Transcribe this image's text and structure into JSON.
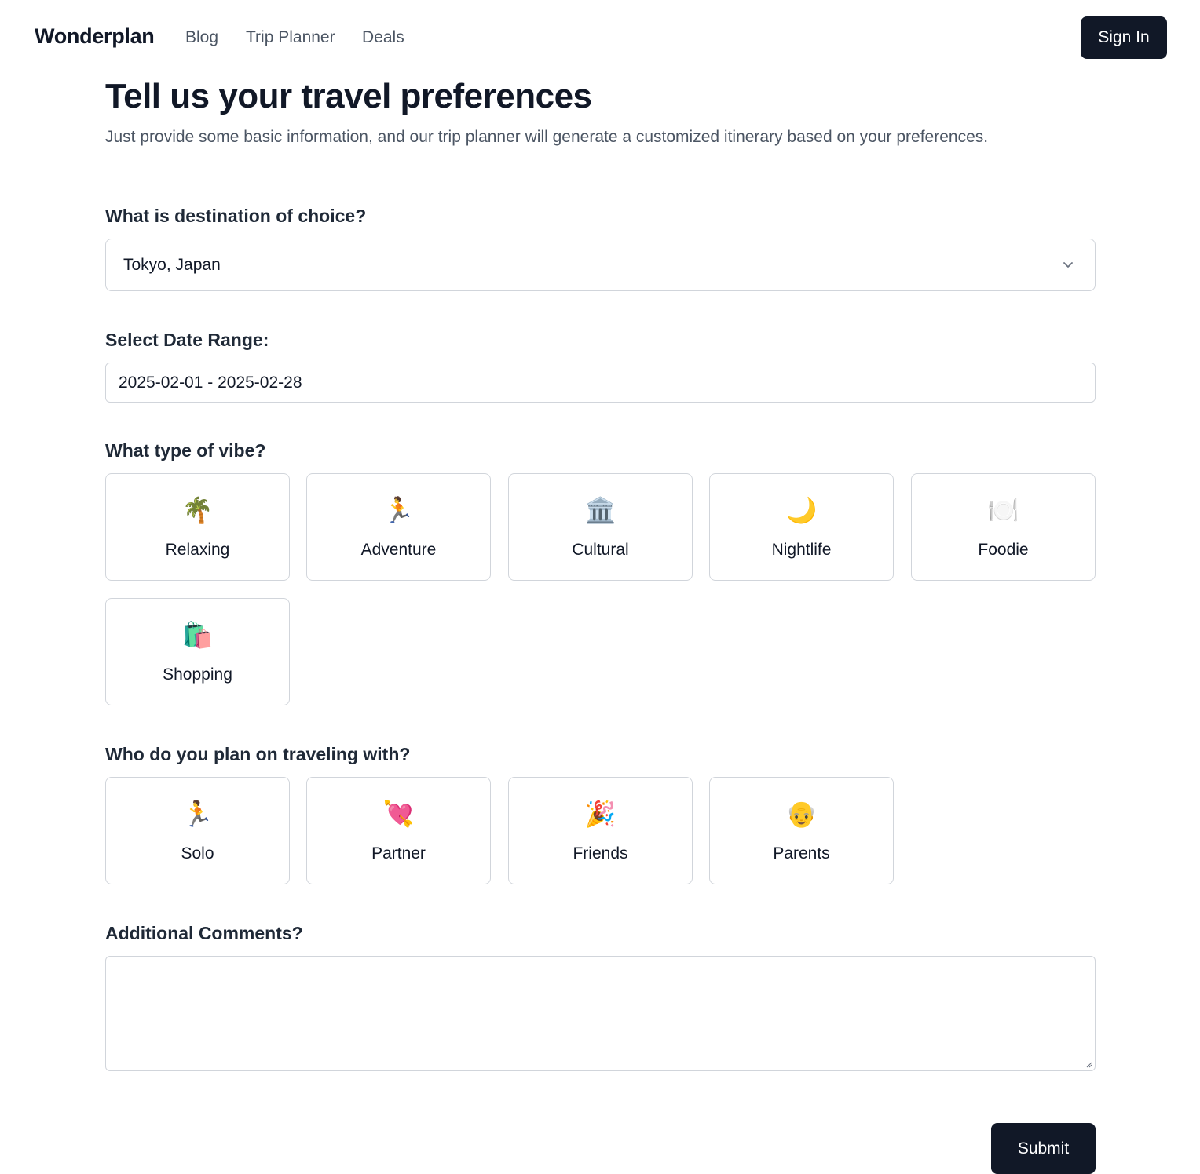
{
  "nav": {
    "logo": "Wonderplan",
    "links": [
      "Blog",
      "Trip Planner",
      "Deals"
    ],
    "signin_label": "Sign In"
  },
  "hero": {
    "title": "Tell us your travel preferences",
    "subtitle": "Just provide some basic information, and our trip planner will generate a customized itinerary based on your preferences."
  },
  "destination": {
    "label": "What is destination of choice?",
    "value": "Tokyo, Japan"
  },
  "dates": {
    "label": "Select Date Range:",
    "value": "2025-02-01 - 2025-02-28"
  },
  "vibe": {
    "label": "What type of vibe?",
    "options": [
      {
        "label": "Relaxing",
        "emoji": "🌴",
        "icon": "palm-tree-icon"
      },
      {
        "label": "Adventure",
        "emoji": "🏃",
        "icon": "runner-icon"
      },
      {
        "label": "Cultural",
        "emoji": "🏛️",
        "icon": "classical-building-icon"
      },
      {
        "label": "Nightlife",
        "emoji": "🌙",
        "icon": "crescent-moon-icon"
      },
      {
        "label": "Foodie",
        "emoji": "🍽️",
        "icon": "plate-cutlery-icon"
      },
      {
        "label": "Shopping",
        "emoji": "🛍️",
        "icon": "shopping-bags-icon"
      }
    ]
  },
  "companions": {
    "label": "Who do you plan on traveling with?",
    "options": [
      {
        "label": "Solo",
        "emoji": "🏃",
        "icon": "runner-icon"
      },
      {
        "label": "Partner",
        "emoji": "💘",
        "icon": "heart-arrow-icon"
      },
      {
        "label": "Friends",
        "emoji": "🎉",
        "icon": "party-popper-icon"
      },
      {
        "label": "Parents",
        "emoji": "👴",
        "icon": "older-person-icon"
      }
    ]
  },
  "comments": {
    "label": "Additional Comments?",
    "value": ""
  },
  "submit_label": "Submit",
  "colors": {
    "primary": "#111827",
    "border": "#d1d5db",
    "muted_text": "#4b5563"
  }
}
